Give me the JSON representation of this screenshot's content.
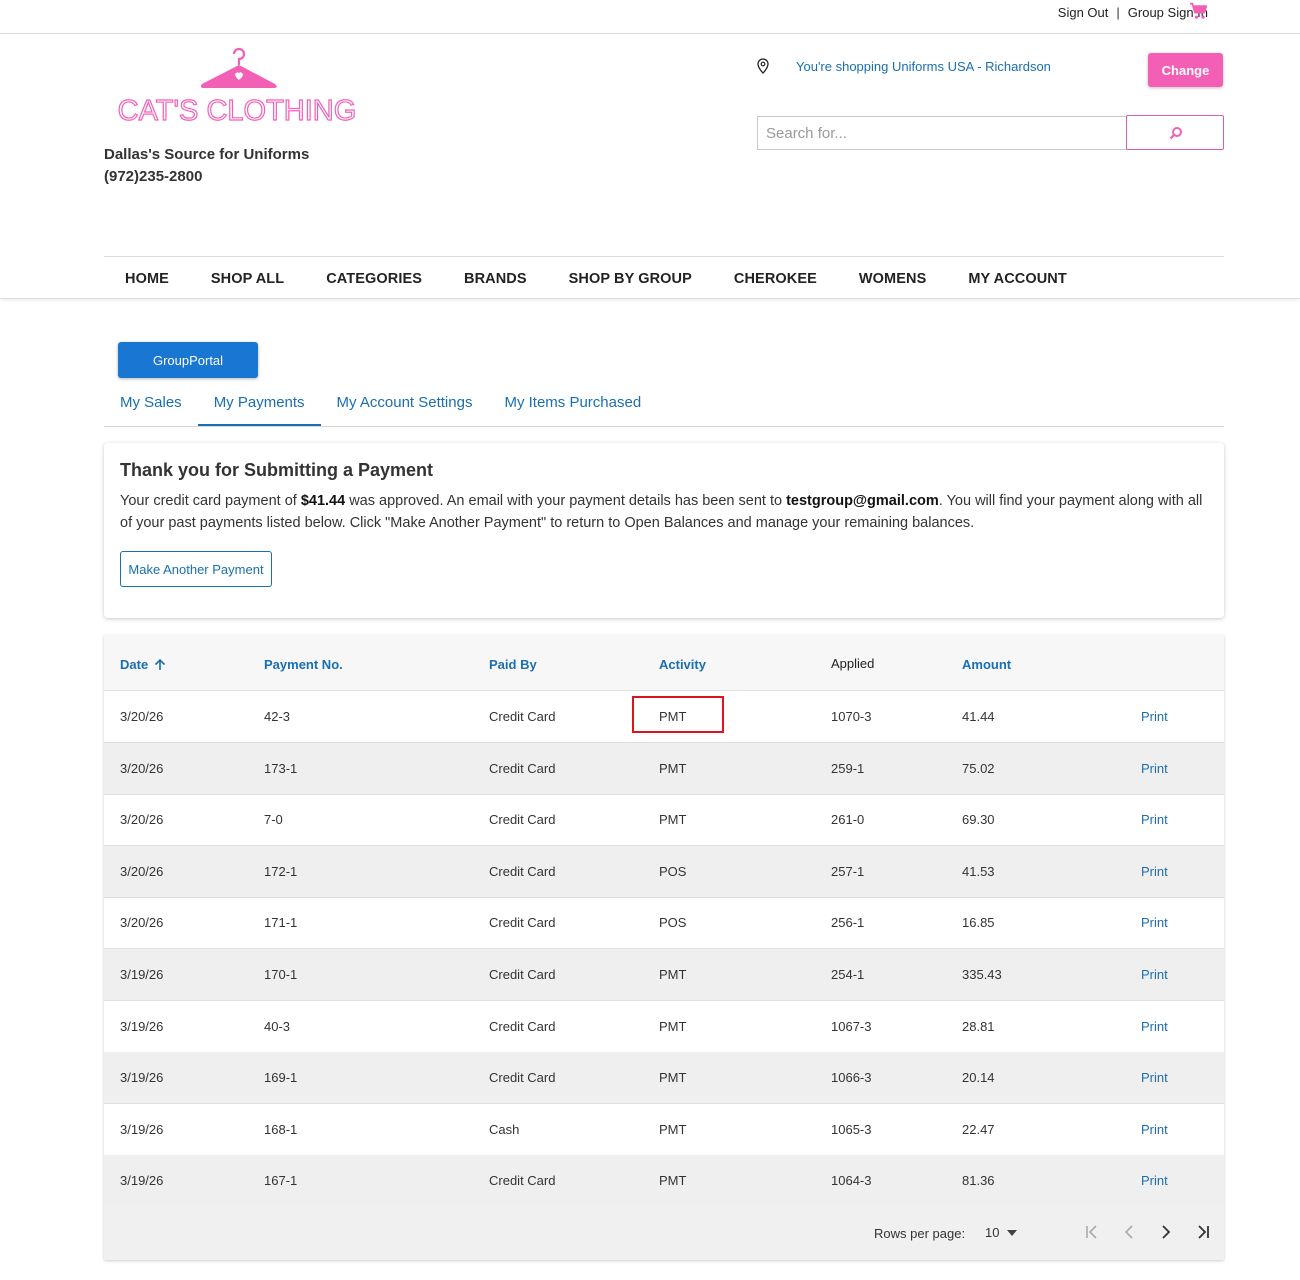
{
  "topbar": {
    "sign_out": "Sign Out",
    "separator": "|",
    "group_sign_in": "Group Sign In"
  },
  "header": {
    "logo_text": "CAT'S CLOTHING",
    "tagline": "Dallas's Source for Uniforms",
    "phone": "(972)235-2800",
    "location_text": "You're shopping Uniforms USA - Richardson",
    "change_label": "Change",
    "search_placeholder": "Search for..."
  },
  "nav": [
    "HOME",
    "SHOP ALL",
    "CATEGORIES",
    "BRANDS",
    "SHOP BY GROUP",
    "CHEROKEE",
    "WOMENS",
    "MY ACCOUNT"
  ],
  "portal": {
    "button_label": "GroupPortal",
    "tabs": [
      "My Sales",
      "My Payments",
      "My Account Settings",
      "My Items Purchased"
    ],
    "active_tab": "My Payments"
  },
  "confirmation": {
    "title": "Thank you for Submitting a Payment",
    "text_1": "Your credit card payment of ",
    "amount": "$41.44",
    "text_2": " was approved. An email with your payment details has been sent to ",
    "email": "testgroup@gmail.com",
    "text_3": ". You will find your payment along with all of your past payments listed below. Click \"Make Another Payment\" to return to Open Balances and manage your remaining balances.",
    "button_label": "Make Another Payment"
  },
  "table": {
    "headers": {
      "date": "Date",
      "payment_no": "Payment No.",
      "paid_by": "Paid By",
      "activity": "Activity",
      "applied": "Applied",
      "amount": "Amount"
    },
    "print_label": "Print",
    "rows": [
      {
        "date": "3/20/26",
        "payment_no": "42-3",
        "paid_by": "Credit Card",
        "activity": "PMT",
        "applied": "1070-3",
        "amount": "41.44"
      },
      {
        "date": "3/20/26",
        "payment_no": "173-1",
        "paid_by": "Credit Card",
        "activity": "PMT",
        "applied": "259-1",
        "amount": "75.02"
      },
      {
        "date": "3/20/26",
        "payment_no": "7-0",
        "paid_by": "Credit Card",
        "activity": "PMT",
        "applied": "261-0",
        "amount": "69.30"
      },
      {
        "date": "3/20/26",
        "payment_no": "172-1",
        "paid_by": "Credit Card",
        "activity": "POS",
        "applied": "257-1",
        "amount": "41.53"
      },
      {
        "date": "3/20/26",
        "payment_no": "171-1",
        "paid_by": "Credit Card",
        "activity": "POS",
        "applied": "256-1",
        "amount": "16.85"
      },
      {
        "date": "3/19/26",
        "payment_no": "170-1",
        "paid_by": "Credit Card",
        "activity": "PMT",
        "applied": "254-1",
        "amount": "335.43"
      },
      {
        "date": "3/19/26",
        "payment_no": "40-3",
        "paid_by": "Credit Card",
        "activity": "PMT",
        "applied": "1067-3",
        "amount": "28.81"
      },
      {
        "date": "3/19/26",
        "payment_no": "169-1",
        "paid_by": "Credit Card",
        "activity": "PMT",
        "applied": "1066-3",
        "amount": "20.14"
      },
      {
        "date": "3/19/26",
        "payment_no": "168-1",
        "paid_by": "Cash",
        "activity": "PMT",
        "applied": "1065-3",
        "amount": "22.47"
      },
      {
        "date": "3/19/26",
        "payment_no": "167-1",
        "paid_by": "Credit Card",
        "activity": "PMT",
        "applied": "1064-3",
        "amount": "81.36"
      }
    ],
    "footer": {
      "rows_per_page_label": "Rows per page:",
      "rows_per_page_value": "10"
    }
  },
  "colors": {
    "brand_pink": "#f45fb6",
    "link_blue": "#1a6fb0",
    "primary_blue": "#1976d2",
    "highlight_red": "#e0121b"
  }
}
